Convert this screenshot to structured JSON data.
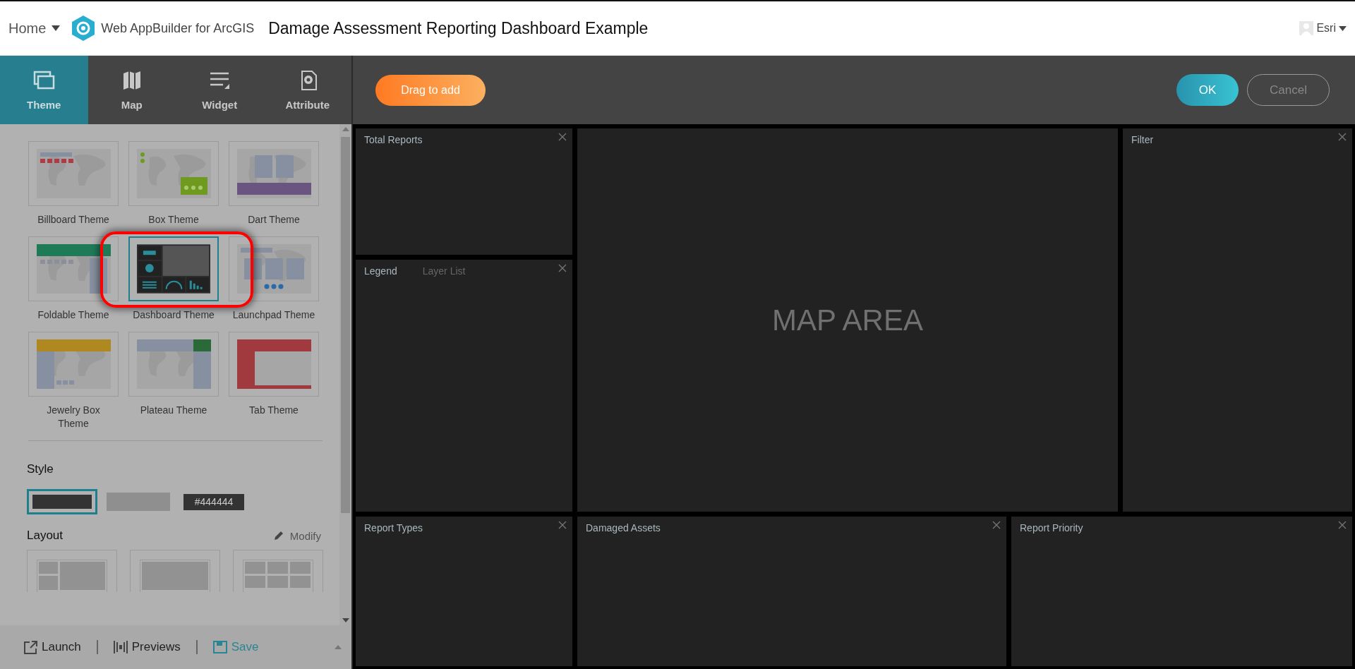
{
  "header": {
    "home": "Home",
    "app_name": "Web AppBuilder for ArcGIS",
    "title": "Damage Assessment Reporting Dashboard Example",
    "user": "Esri"
  },
  "tabs": [
    {
      "label": "Theme",
      "kind": "theme",
      "selected": true
    },
    {
      "label": "Map",
      "kind": "map",
      "selected": false
    },
    {
      "label": "Widget",
      "kind": "widget",
      "selected": false
    },
    {
      "label": "Attribute",
      "kind": "attribute",
      "selected": false
    }
  ],
  "toolbar": {
    "drag": "Drag to add",
    "ok": "OK",
    "cancel": "Cancel"
  },
  "themes": [
    {
      "label": "Billboard Theme",
      "kind": "billboard",
      "selected": false
    },
    {
      "label": "Box Theme",
      "kind": "box",
      "selected": false
    },
    {
      "label": "Dart Theme",
      "kind": "dart",
      "selected": false
    },
    {
      "label": "Foldable Theme",
      "kind": "foldable",
      "selected": false
    },
    {
      "label": "Dashboard Theme",
      "kind": "dashboard",
      "selected": true
    },
    {
      "label": "Launchpad Theme",
      "kind": "launchpad",
      "selected": false
    },
    {
      "label": "Jewelry Box Theme",
      "kind": "jewelry",
      "selected": false
    },
    {
      "label": "Plateau Theme",
      "kind": "plateau",
      "selected": false
    },
    {
      "label": "Tab Theme",
      "kind": "tab",
      "selected": false
    }
  ],
  "style": {
    "heading": "Style",
    "swatches": [
      {
        "color": "#333333",
        "selected": true
      },
      {
        "color": "#8f8f8f",
        "selected": false
      }
    ],
    "hex": "#444444"
  },
  "layout": {
    "heading": "Layout",
    "modify": "Modify",
    "options": [
      {
        "kind": "left-stack"
      },
      {
        "kind": "wide"
      },
      {
        "kind": "grid"
      }
    ]
  },
  "footer": {
    "launch": "Launch",
    "previews": "Previews",
    "save": "Save"
  },
  "top_panels": [
    {
      "tabs": [
        {
          "label": "Total Reports",
          "selected": true
        }
      ]
    },
    {
      "tabs": [
        {
          "label": "Legend",
          "selected": true
        },
        {
          "label": "Layer List",
          "selected": false
        }
      ]
    }
  ],
  "map_area": "MAP AREA",
  "side_panel": {
    "tabs": [
      {
        "label": "Filter",
        "selected": true
      }
    ]
  },
  "bottom_panels": [
    {
      "tabs": [
        {
          "label": "Report Types",
          "selected": true
        }
      ]
    },
    {
      "tabs": [
        {
          "label": "Damaged Assets",
          "selected": true
        }
      ]
    },
    {
      "tabs": [
        {
          "label": "Report Priority",
          "selected": true
        }
      ]
    }
  ]
}
